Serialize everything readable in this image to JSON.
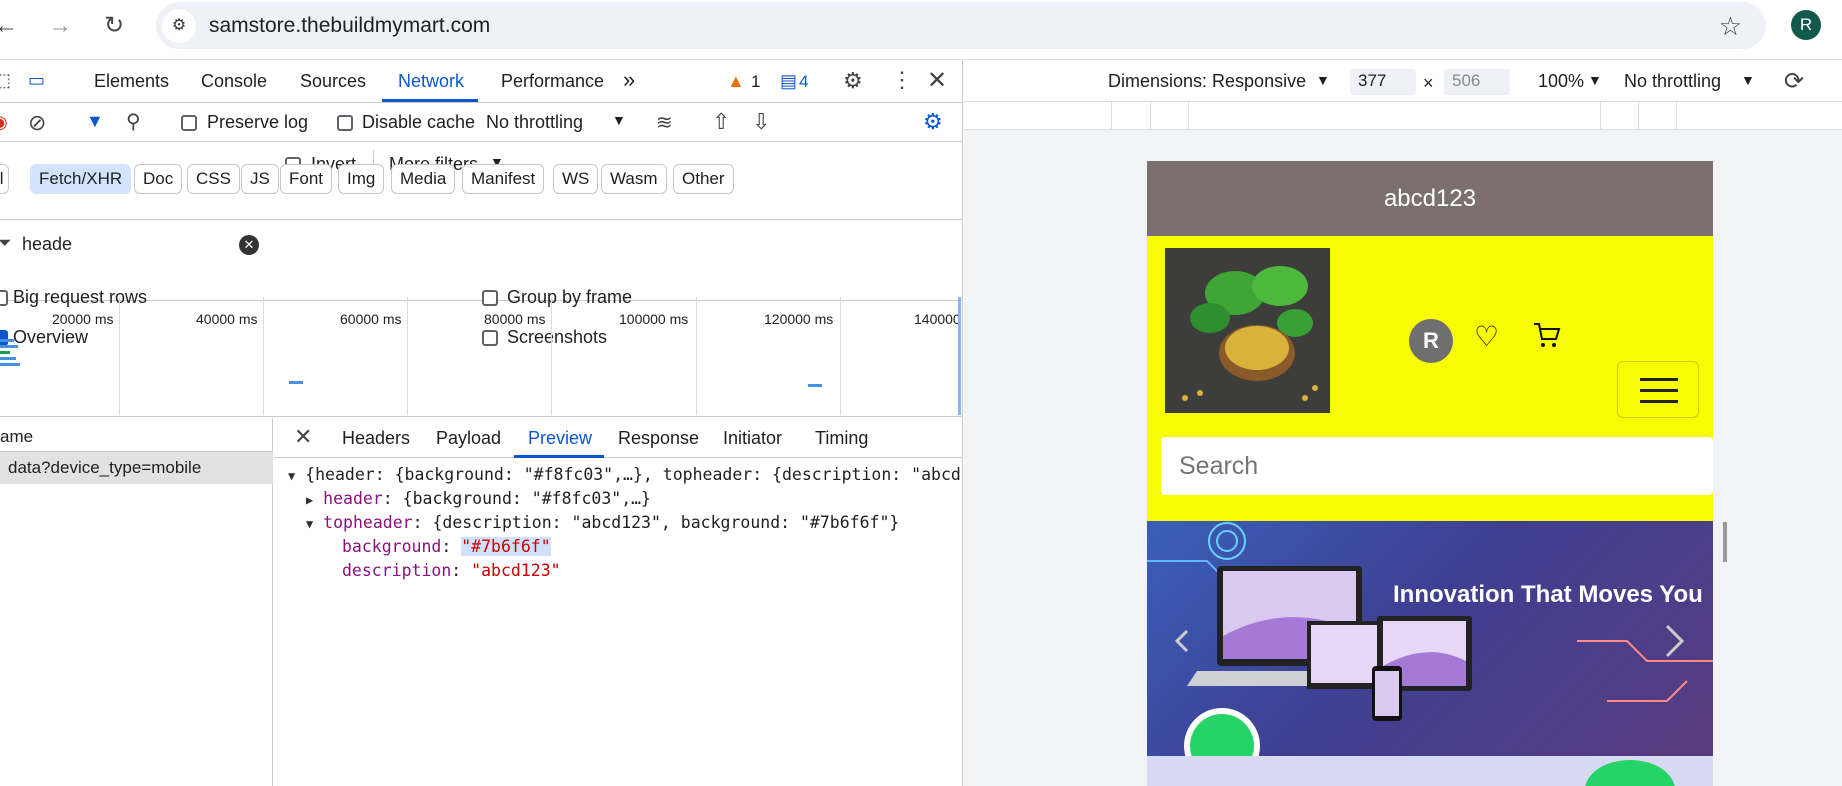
{
  "browser": {
    "url": "samstore.thebuildmymart.com",
    "profile_initial": "R"
  },
  "devtools": {
    "tabs": [
      "Elements",
      "Console",
      "Sources",
      "Network",
      "Performance"
    ],
    "more_tabs": "»",
    "warnings_count": "1",
    "messages_count": "4",
    "toolbar": {
      "preserve_log": "Preserve log",
      "disable_cache": "Disable cache",
      "throttling": "No throttling"
    },
    "filter": {
      "value": "heade",
      "invert": "Invert",
      "more_filters": "More filters",
      "types": [
        "ll",
        "Fetch/XHR",
        "Doc",
        "CSS",
        "JS",
        "Font",
        "Img",
        "Media",
        "Manifest",
        "WS",
        "Wasm",
        "Other"
      ],
      "selected_type": "Fetch/XHR"
    },
    "options": {
      "big_request_rows": "Big request rows",
      "group_by_frame": "Group by frame",
      "overview": "Overview",
      "screenshots": "Screenshots"
    },
    "timeline": [
      "20000 ms",
      "40000 ms",
      "60000 ms",
      "80000 ms",
      "100000 ms",
      "120000 ms",
      "140000"
    ],
    "requests": {
      "column": "ame",
      "items": [
        "data?device_type=mobile"
      ]
    },
    "details": {
      "tabs": [
        "Headers",
        "Payload",
        "Preview",
        "Response",
        "Initiator",
        "Timing"
      ],
      "active_tab": "Preview",
      "preview": {
        "root": "{header: {background: \"#f8fc03\",…}, topheader: {description: \"abcd",
        "header_key": "header",
        "header_value": ": {background: \"#f8fc03\",…}",
        "topheader_key": "topheader",
        "topheader_value": ": {description: \"abcd123\", background: \"#7b6f6f\"}",
        "bg_key": "background",
        "bg_value": "\"#7b6f6f\"",
        "desc_key": "description",
        "desc_value": "\"abcd123\""
      }
    }
  },
  "device_toolbar": {
    "dimensions": "Dimensions: Responsive",
    "width": "377",
    "times": "×",
    "height": "506",
    "zoom": "100%",
    "throttling": "No throttling"
  },
  "site": {
    "topheader_text": "abcd123",
    "topheader_bg": "#7b6f6f",
    "header_bg": "#f8fc03",
    "avatar_initial": "R",
    "search_placeholder": "Search",
    "banner_title": "Innovation That Moves You"
  }
}
